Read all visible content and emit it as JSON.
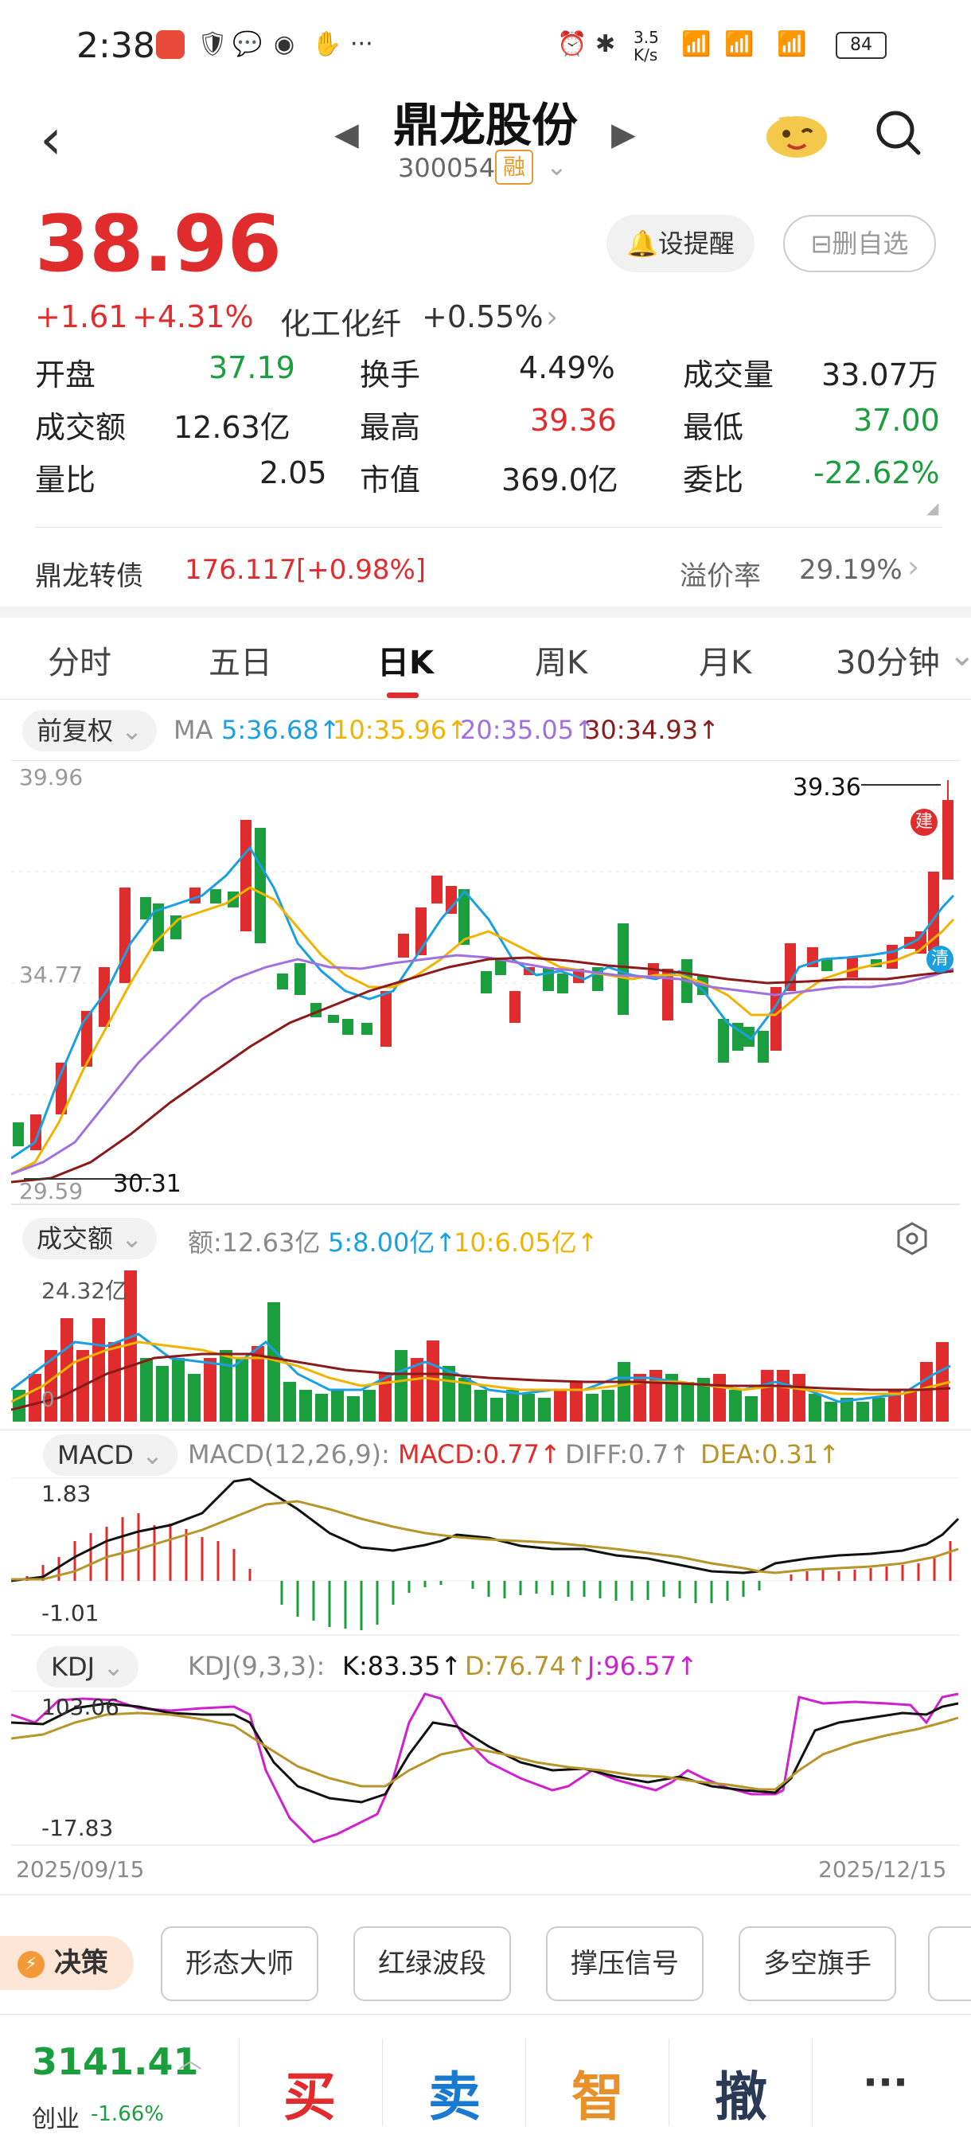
{
  "status": {
    "time": "2:38",
    "net_speed": "3.5 K/s",
    "battery": "84"
  },
  "header": {
    "title": "鼎龙股份",
    "code": "300054",
    "margin_badge": "融"
  },
  "quote": {
    "price": "38.96",
    "change": "+1.61",
    "change_pct": "+4.31%",
    "sector": "化工化纤",
    "sector_pct": "+0.55%",
    "alert_label": "设提醒",
    "remove_label": "删自选",
    "stats": [
      {
        "label": "开盘",
        "value": "37.19",
        "color": "green"
      },
      {
        "label": "换手",
        "value": "4.49%",
        "color": "normal"
      },
      {
        "label": "成交量",
        "value": "33.07万",
        "color": "normal"
      },
      {
        "label": "成交额",
        "value": "12.63亿",
        "color": "normal"
      },
      {
        "label": "最高",
        "value": "39.36",
        "color": "red"
      },
      {
        "label": "最低",
        "value": "37.00",
        "color": "green"
      },
      {
        "label": "量比",
        "value": "2.05",
        "color": "normal"
      },
      {
        "label": "市值",
        "value": "369.0亿",
        "color": "normal"
      },
      {
        "label": "委比",
        "value": "-22.62%",
        "color": "green"
      }
    ],
    "bond_label": "鼎龙转债",
    "bond_price": "176.117",
    "bond_pct": "[+0.98%]",
    "premium_label": "溢价率",
    "premium_value": "29.19%"
  },
  "tabs": [
    "分时",
    "五日",
    "日K",
    "周K",
    "月K",
    "30分钟"
  ],
  "kline": {
    "adjust": "前复权",
    "ma_label": "MA",
    "ma5": "5:36.68↑",
    "ma10": "10:35.96↑",
    "ma20": "20:35.05↑",
    "ma30": "30:34.93↑",
    "y_top": "39.96",
    "y_mid": "34.77",
    "y_bot": "29.59",
    "high_label": "39.36",
    "low_label": "30.31",
    "tag_build": "建",
    "tag_clear": "清"
  },
  "volume": {
    "title": "成交额",
    "amount": "额:12.63亿",
    "ma5": "5:8.00亿↑",
    "ma10": "10:6.05亿↑",
    "y_top": "24.32亿",
    "y_zero": "0"
  },
  "macd": {
    "title": "MACD",
    "params": "MACD(12,26,9):",
    "macd": "MACD:0.77↑",
    "diff": "DIFF:0.7↑",
    "dea": "DEA:0.31↑",
    "y_top": "1.83",
    "y_bot": "-1.01"
  },
  "kdj": {
    "title": "KDJ",
    "params": "KDJ(9,3,3):",
    "k": "K:83.35↑",
    "d": "D:76.74↑",
    "j": "J:96.57↑",
    "y_top": "103.06",
    "y_bot": "-17.83",
    "date_start": "2025/09/15",
    "date_end": "2025/12/15"
  },
  "tools": {
    "decision": "决策",
    "items": [
      "形态大师",
      "红绿波段",
      "撑压信号",
      "多空旗手"
    ]
  },
  "bottom": {
    "index_value": "3141.41",
    "index_name": "创业",
    "index_pct": "-1.66%",
    "buy": "买",
    "sell": "卖",
    "smart": "智",
    "cancel": "撤",
    "more": "···"
  },
  "colors": {
    "red": "#e02c2c",
    "green": "#1b9e3e",
    "ma5": "#1aa0e0",
    "ma10": "#f0b400",
    "ma20": "#a070e0",
    "ma30": "#8b1a1a"
  }
}
